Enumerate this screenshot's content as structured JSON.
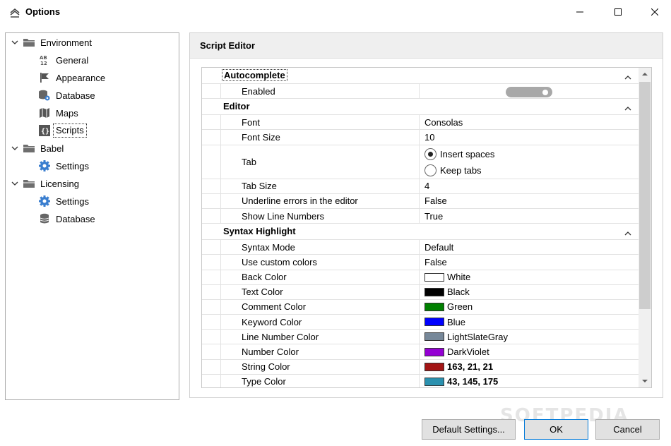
{
  "window": {
    "title": "Options",
    "icon": "stacked-layers-icon",
    "controls": [
      "minimize-icon",
      "maximize-icon",
      "close-icon"
    ]
  },
  "tree": {
    "items": [
      {
        "label": "Environment",
        "level": 0,
        "expanded": true,
        "icon": "folder-icon"
      },
      {
        "label": "General",
        "level": 1,
        "icon": "ab-12-icon"
      },
      {
        "label": "Appearance",
        "level": 1,
        "icon": "flag-icon"
      },
      {
        "label": "Database",
        "level": 1,
        "icon": "database-gear-icon"
      },
      {
        "label": "Maps",
        "level": 1,
        "icon": "map-icon"
      },
      {
        "label": "Scripts",
        "level": 1,
        "icon": "braces-icon",
        "selected": true
      },
      {
        "label": "Babel",
        "level": 0,
        "expanded": true,
        "icon": "folder-icon"
      },
      {
        "label": "Settings",
        "level": 1,
        "icon": "gear-icon"
      },
      {
        "label": "Licensing",
        "level": 0,
        "expanded": true,
        "icon": "folder-icon"
      },
      {
        "label": "Settings",
        "level": 1,
        "icon": "gear-icon"
      },
      {
        "label": "Database",
        "level": 1,
        "icon": "database-icon"
      }
    ]
  },
  "panel": {
    "title": "Script Editor",
    "categories": [
      {
        "title": "Autocomplete",
        "props": [
          {
            "name": "Enabled",
            "type": "toggle",
            "on": true
          }
        ]
      },
      {
        "title": "Editor",
        "props": [
          {
            "name": "Font",
            "value": "Consolas"
          },
          {
            "name": "Font Size",
            "value": "10"
          },
          {
            "name": "Tab",
            "type": "radio",
            "options": [
              "Insert spaces",
              "Keep tabs"
            ],
            "selected": 0
          },
          {
            "name": "Tab Size",
            "value": "4"
          },
          {
            "name": "Underline errors in the editor",
            "value": "False"
          },
          {
            "name": "Show Line Numbers",
            "value": "True"
          }
        ]
      },
      {
        "title": "Syntax Highlight",
        "props": [
          {
            "name": "Syntax Mode",
            "value": "Default"
          },
          {
            "name": "Use custom colors",
            "value": "False"
          },
          {
            "name": "Back Color",
            "value": "White",
            "color": "#ffffff"
          },
          {
            "name": "Text Color",
            "value": "Black",
            "color": "#000000"
          },
          {
            "name": "Comment Color",
            "value": "Green",
            "color": "#008000"
          },
          {
            "name": "Keyword Color",
            "value": "Blue",
            "color": "#0000ff"
          },
          {
            "name": "Line Number Color",
            "value": "LightSlateGray",
            "color": "#778899"
          },
          {
            "name": "Number Color",
            "value": "DarkViolet",
            "color": "#9400d3"
          },
          {
            "name": "String Color",
            "value": "163, 21, 21",
            "color": "#a31515",
            "bold": true
          },
          {
            "name": "Type Color",
            "value": "43, 145, 175",
            "color": "#2b91af",
            "bold": true
          }
        ]
      }
    ]
  },
  "buttons": {
    "default_settings": "Default Settings...",
    "ok": "OK",
    "cancel": "Cancel"
  },
  "watermark": "SOFTPEDIA"
}
